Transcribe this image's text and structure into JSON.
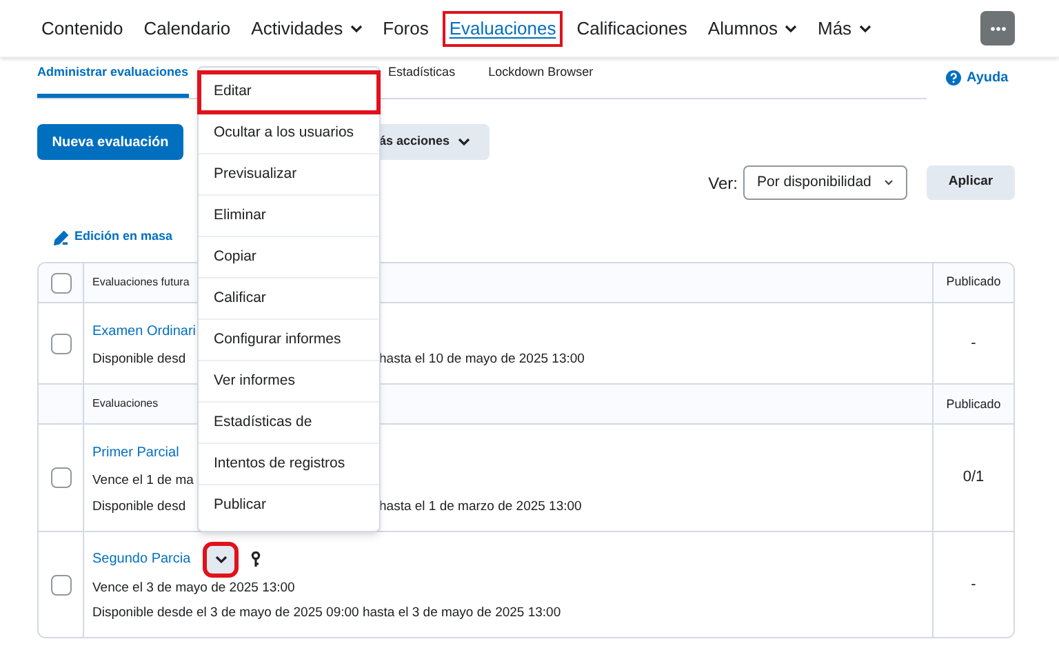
{
  "nav": [
    {
      "label": "Contenido",
      "dropdown": false,
      "selected": false,
      "highlighted": false
    },
    {
      "label": "Calendario",
      "dropdown": false,
      "selected": false,
      "highlighted": false
    },
    {
      "label": "Actividades",
      "dropdown": true,
      "selected": false,
      "highlighted": false
    },
    {
      "label": "Foros",
      "dropdown": false,
      "selected": false,
      "highlighted": false
    },
    {
      "label": "Evaluaciones",
      "dropdown": false,
      "selected": true,
      "highlighted": true
    },
    {
      "label": "Calificaciones",
      "dropdown": false,
      "selected": false,
      "highlighted": false
    },
    {
      "label": "Alumnos",
      "dropdown": true,
      "selected": false,
      "highlighted": false
    },
    {
      "label": "Más",
      "dropdown": true,
      "selected": false,
      "highlighted": false
    }
  ],
  "subtabs": [
    {
      "label": "Administrar evaluaciones",
      "selected": true
    },
    {
      "label": "Estadísticas",
      "selected": false
    },
    {
      "label": "Lockdown Browser",
      "selected": false
    }
  ],
  "help": "Ayuda",
  "new_button": "Nueva evaluación",
  "more_actions_button": "ás acciones",
  "view": {
    "label": "Ver:",
    "value": "Por disponibilidad"
  },
  "apply_button": "Aplicar",
  "bulk_edit": "Edición en masa",
  "table": {
    "sections": [
      {
        "header": "Evaluaciones futura",
        "published_header": "Publicado",
        "select_all": {
          "checked": false
        },
        "rows": [
          {
            "title": "Examen Ordinari",
            "checked": false,
            "published": "-",
            "lines": [
              {
                "left": "Disponible desd",
                "right": "hasta el 10 de mayo de 2025 13:00"
              }
            ]
          }
        ]
      },
      {
        "header": "Evaluaciones",
        "published_header": "Publicado",
        "rows": [
          {
            "title": "Primer Parcial",
            "checked": false,
            "published": "0/1",
            "lines": [
              {
                "left": "Vence el 1 de ma"
              },
              {
                "left": "Disponible desd",
                "right": "hasta el 1 de marzo de 2025 13:00"
              }
            ]
          },
          {
            "title": "Segundo Parcia",
            "checked": false,
            "has_key": true,
            "menu_highlighted": true,
            "published": "-",
            "lines": [
              {
                "left": "Vence el 3 de mayo de 2025 13:00"
              },
              {
                "left": "Disponible desde el 3 de mayo de 2025 09:00 hasta el 3 de mayo de 2025 13:00"
              }
            ]
          }
        ]
      }
    ]
  },
  "menu": [
    {
      "label": "Editar",
      "highlighted": true
    },
    {
      "label": "Ocultar a los usuarios",
      "highlighted": false
    },
    {
      "label": "Previsualizar",
      "highlighted": false
    },
    {
      "label": "Eliminar",
      "highlighted": false
    },
    {
      "label": "Copiar",
      "highlighted": false
    },
    {
      "label": "Calificar",
      "highlighted": false
    },
    {
      "label": "Configurar informes",
      "highlighted": false
    },
    {
      "label": "Ver informes",
      "highlighted": false
    },
    {
      "label": "Estadísticas de",
      "highlighted": false
    },
    {
      "label": "Intentos de registros",
      "highlighted": false
    },
    {
      "label": "Publicar",
      "highlighted": false
    }
  ]
}
